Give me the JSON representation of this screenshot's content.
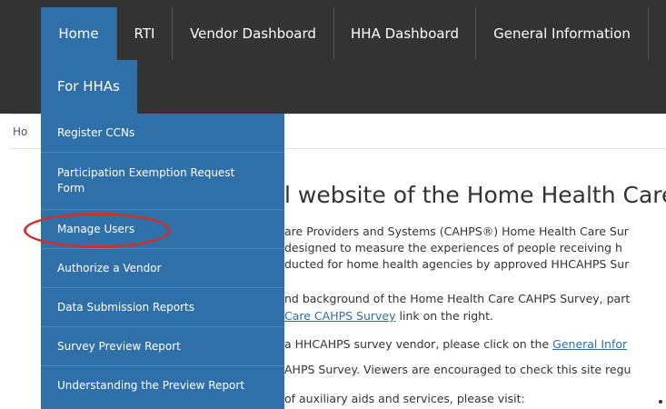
{
  "nav": {
    "items": [
      "Home",
      "RTI",
      "Vendor Dashboard",
      "HHA Dashboard",
      "General Information"
    ],
    "submenu_label": "For HHAs"
  },
  "breadcrumb": "Ho",
  "dropdown": {
    "items": [
      "Register CCNs",
      "Participation Exemption Request Form",
      "Manage Users",
      "Authorize a Vendor",
      "Data Submission Reports",
      "Survey Preview Report",
      "Understanding the Preview Report"
    ]
  },
  "content": {
    "heading": "l website of the Home Health Care C",
    "p1_line1": "are Providers and Systems (CAHPS®) Home Health Care Sur",
    "p1_line2": "designed to measure the experiences of people receiving h",
    "p1_line3": "ducted for home health agencies by approved HHCAHPS Sur",
    "p2_line1": "nd background of the Home Health Care CAHPS Survey, part",
    "p2_link": "Care CAHPS Survey",
    "p2_line2_rest": " link on the right.",
    "p3_line1_pre": " a HHCAHPS survey vendor, please click on the ",
    "p3_link": "General Infor",
    "p3_line2": "AHPS Survey. Viewers are encouraged to check this site regu",
    "p4_line1": "of auxiliary aids and services, please visit:"
  },
  "colors": {
    "nav_bg": "#333333",
    "accent_blue": "#2f70a8",
    "highlight_red": "#c7322f"
  }
}
